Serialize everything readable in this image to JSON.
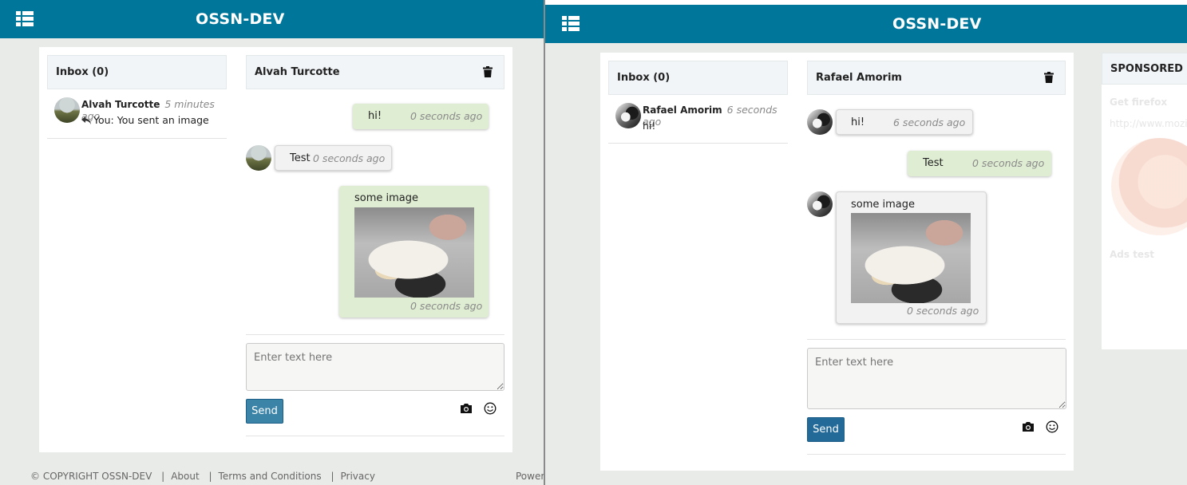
{
  "left_window": {
    "site_title": "OSSN-DEV",
    "inbox": {
      "header": "Inbox (0)",
      "items": [
        {
          "name": "Alvah Turcotte",
          "time": "5 minutes ago",
          "preview": "You: You sent an image",
          "icon": "reply-icon"
        }
      ]
    },
    "conversation": {
      "title": "Alvah Turcotte",
      "messages": [
        {
          "direction": "sent",
          "text": "hi!",
          "time": "0 seconds ago"
        },
        {
          "direction": "received",
          "text": "Test",
          "time": "0 seconds ago"
        },
        {
          "direction": "sent",
          "text": "some image",
          "time": "0 seconds ago",
          "has_image": true
        }
      ],
      "composer": {
        "placeholder": "Enter text here",
        "send_label": "Send"
      }
    },
    "footer": {
      "copyright": "© COPYRIGHT OSSN-DEV",
      "links": [
        "About",
        "Terms and Conditions",
        "Privacy"
      ],
      "powered": "Power"
    }
  },
  "right_window": {
    "site_title": "OSSN-DEV",
    "inbox": {
      "header": "Inbox (0)",
      "items": [
        {
          "name": "Rafael Amorim",
          "time": "6 seconds ago",
          "preview": "hi!"
        }
      ]
    },
    "conversation": {
      "title": "Rafael Amorim",
      "messages": [
        {
          "direction": "received",
          "text": "hi!",
          "time": "6 seconds ago"
        },
        {
          "direction": "sent",
          "text": "Test",
          "time": "0 seconds ago"
        },
        {
          "direction": "received",
          "text": "some image",
          "time": "0 seconds ago",
          "has_image": true
        }
      ],
      "composer": {
        "placeholder": "Enter text here",
        "send_label": "Send"
      }
    },
    "sponsored": {
      "header": "SPONSORED",
      "ad_title": "Get firefox",
      "ad_url": "http://www.mozilla.org",
      "ad_text": "Ads test"
    }
  },
  "colors": {
    "brand_bar": "#00779a",
    "sent_bubble": "#dfedd2",
    "received_bubble": "#f1f2f1",
    "send_button_left": "#3b84a8",
    "send_button_right": "#236a98"
  }
}
